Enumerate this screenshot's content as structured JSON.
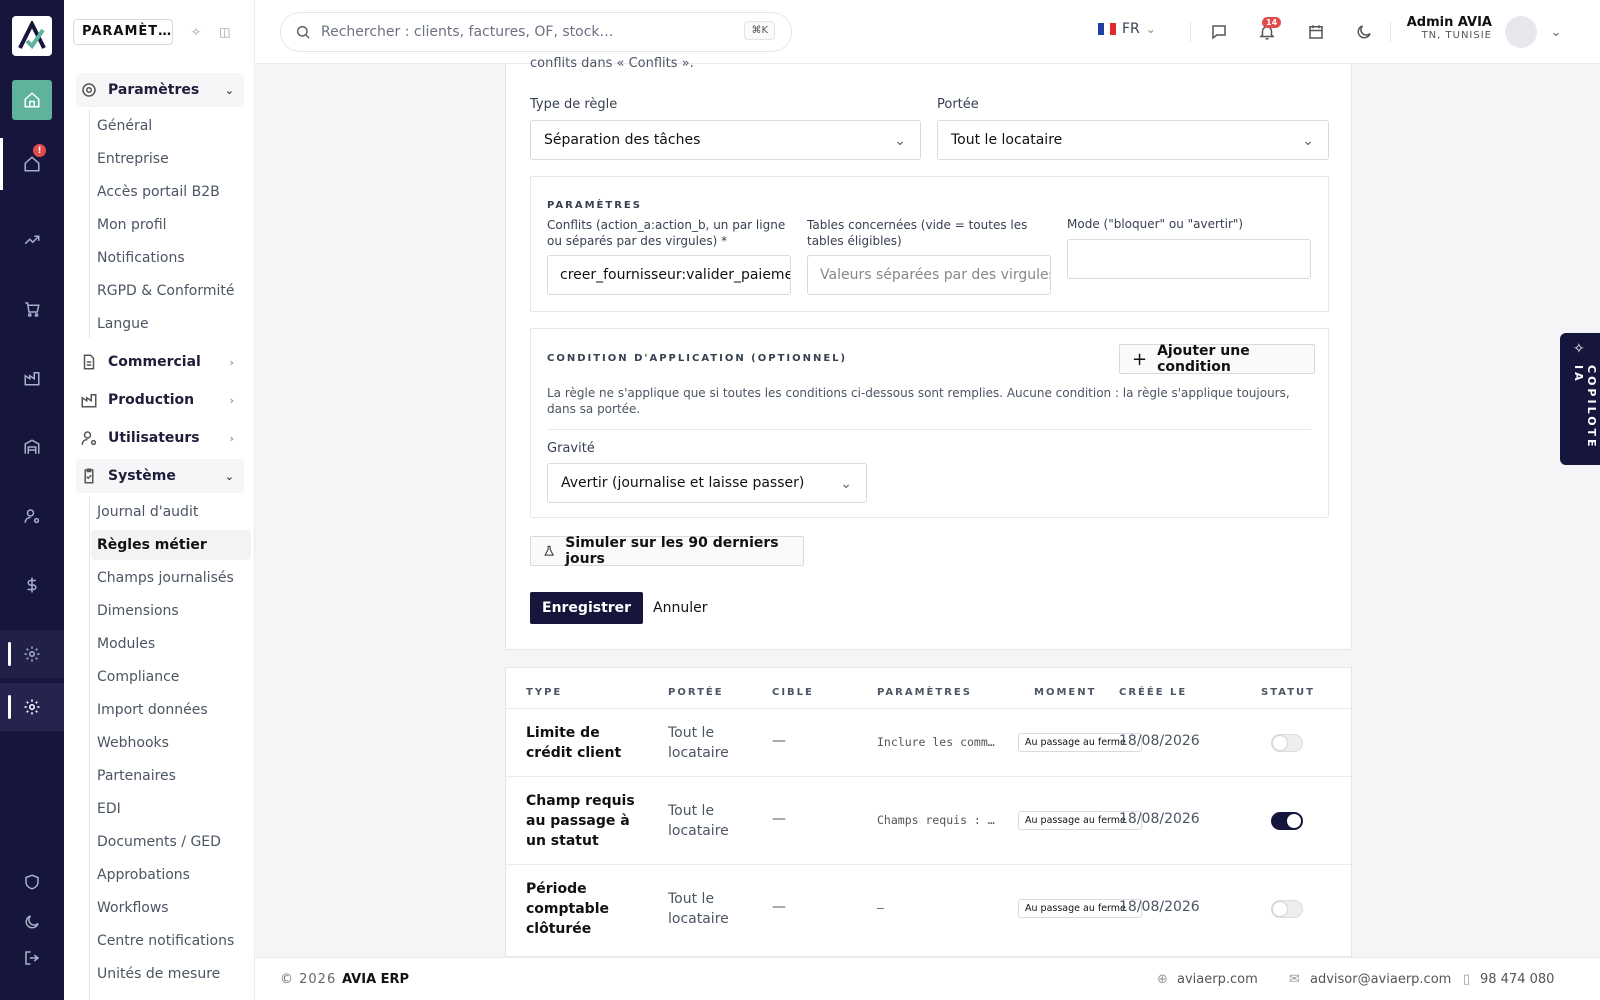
{
  "app": {
    "name": "AVIA ERP"
  },
  "rail": {
    "home_badge": "!"
  },
  "sidebar": {
    "section_title": "PARAMÈT…",
    "groups": [
      {
        "label": "Paramètres"
      },
      {
        "label": "Commercial"
      },
      {
        "label": "Production"
      },
      {
        "label": "Utilisateurs"
      },
      {
        "label": "Système"
      }
    ],
    "parametres_items": [
      "Général",
      "Entreprise",
      "Accès portail B2B",
      "Mon profil",
      "Notifications",
      "RGPD & Conformité",
      "Langue"
    ],
    "systeme_items": [
      "Journal d'audit",
      "Règles métier",
      "Champs journalisés",
      "Dimensions",
      "Modules",
      "Compliance",
      "Import données",
      "Webhooks",
      "Partenaires",
      "EDI",
      "Documents / GED",
      "Approbations",
      "Workflows",
      "Centre notifications",
      "Unités de mesure"
    ]
  },
  "topbar": {
    "search_placeholder": "Rechercher : clients, factures, OF, stock…",
    "shortcut": "⌘K",
    "lang": "FR",
    "notif_count": "14",
    "user_name": "Admin AVIA",
    "user_location": "TN, TUNISIE"
  },
  "form": {
    "cut_text": "conflits dans « Conflits ».",
    "type_label": "Type de règle",
    "type_value": "Séparation des tâches",
    "scope_label": "Portée",
    "scope_value": "Tout le locataire",
    "params_title": "PARAMÈTRES",
    "conflicts_label": "Conflits (action_a:action_b, un par ligne ou séparés par des virgules) *",
    "conflicts_value": "creer_fournisseur:valider_paiement",
    "tables_label": "Tables concernées (vide = toutes les tables éligibles)",
    "tables_placeholder": "Valeurs séparées par des virgules",
    "mode_label": "Mode (\"bloquer\" ou \"avertir\")",
    "mode_value": "",
    "condition_title": "CONDITION D'APPLICATION (OPTIONNEL)",
    "add_condition": "Ajouter une condition",
    "condition_help": "La règle ne s'applique que si toutes les conditions ci-dessous sont remplies. Aucune condition : la règle s'applique toujours, dans sa portée.",
    "severity_label": "Gravité",
    "severity_value": "Avertir (journalise et laisse passer)",
    "simulate": "Simuler sur les 90 derniers jours",
    "save": "Enregistrer",
    "cancel": "Annuler"
  },
  "table": {
    "headers": [
      "TYPE",
      "PORTÉE",
      "CIBLE",
      "PARAMÈTRES",
      "MOMENT",
      "CRÉÉE LE",
      "STATUT"
    ],
    "rows": [
      {
        "type": "Limite de crédit client",
        "scope": "Tout le locataire",
        "target": "—",
        "params": "Inclure les commandes",
        "moment": "Au passage au ferme",
        "created": "18/08/2026",
        "enabled": false
      },
      {
        "type": "Champ requis au passage à un statut",
        "scope": "Tout le locataire",
        "target": "—",
        "params": "Champs requis : …",
        "moment": "Au passage au ferme",
        "created": "18/08/2026",
        "enabled": true
      },
      {
        "type": "Période comptable clôturée",
        "scope": "Tout le locataire",
        "target": "—",
        "params": "—",
        "moment": "Au passage au ferme",
        "created": "18/08/2026",
        "enabled": false
      }
    ]
  },
  "copilot": {
    "label": "COPILOTE IA"
  },
  "footer": {
    "copyright": "© 2026",
    "brand": "AVIA ERP",
    "site": "aviaerp.com",
    "email": "advisor@aviaerp.com",
    "phone": "98 474 080"
  },
  "colors": {
    "primary": "#16163d",
    "accent": "#5fb39a",
    "badge": "#e24b4b"
  }
}
